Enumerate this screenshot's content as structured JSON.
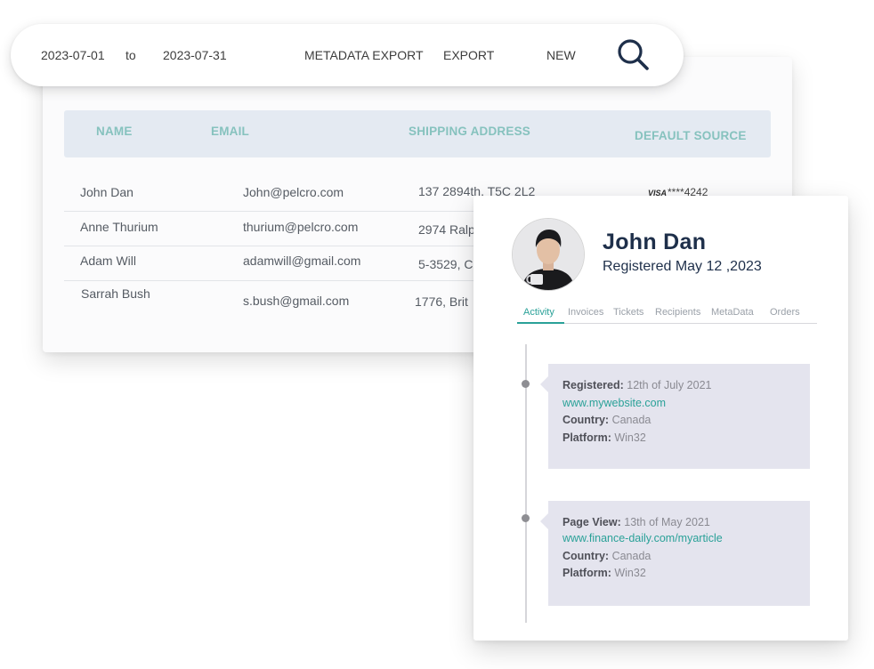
{
  "toolbar": {
    "date_from": "2023-07-01",
    "date_separator": "to",
    "date_to": "2023-07-31",
    "metadata_export_label": "METADATA EXPORT",
    "export_label": "EXPORT",
    "new_label": "NEW",
    "search_icon": "search-icon"
  },
  "table": {
    "columns": [
      "NAME",
      "EMAIL",
      "SHIPPING ADDRESS",
      "DEFAULT SOURCE"
    ],
    "rows": [
      {
        "name": "John Dan",
        "email": "John@pelcro.com",
        "address": "137 2894th, T5C 2L2",
        "source_brand": "VISA",
        "source_number": "****4242"
      },
      {
        "name": "Anne Thurium",
        "email": "thurium@pelcro.com",
        "address": "2974 Ralp"
      },
      {
        "name": "Adam Will",
        "email": "adamwill@gmail.com",
        "address": "5-3529, C"
      },
      {
        "name": "Sarrah Bush",
        "email": "s.bush@gmail.com",
        "address": "1776, Brit"
      }
    ]
  },
  "profile": {
    "name": "John Dan",
    "registered": "Registered May 12 ,2023",
    "tabs": [
      "Activity",
      "Invoices",
      "Tickets",
      "Recipients",
      "MetaData",
      "Orders"
    ],
    "active_tab": "Activity",
    "events": [
      {
        "title_label": "Registered:",
        "title_value": "12th of July 2021",
        "link": "www.mywebsite.com",
        "country_label": "Country:",
        "country_value": "Canada",
        "platform_label": "Platform:",
        "platform_value": "Win32"
      },
      {
        "title_label": "Page View:",
        "title_value": "13th of May 2021",
        "link": "www.finance-daily.com/myarticle",
        "country_label": "Country:",
        "country_value": "Canada",
        "platform_label": "Platform:",
        "platform_value": "Win32"
      }
    ]
  },
  "colors": {
    "accent": "#2aa198",
    "header_text": "#86c2be",
    "header_bg": "#e4eaf2",
    "navy": "#1e2f4a",
    "event_bg": "#e4e4ee"
  }
}
